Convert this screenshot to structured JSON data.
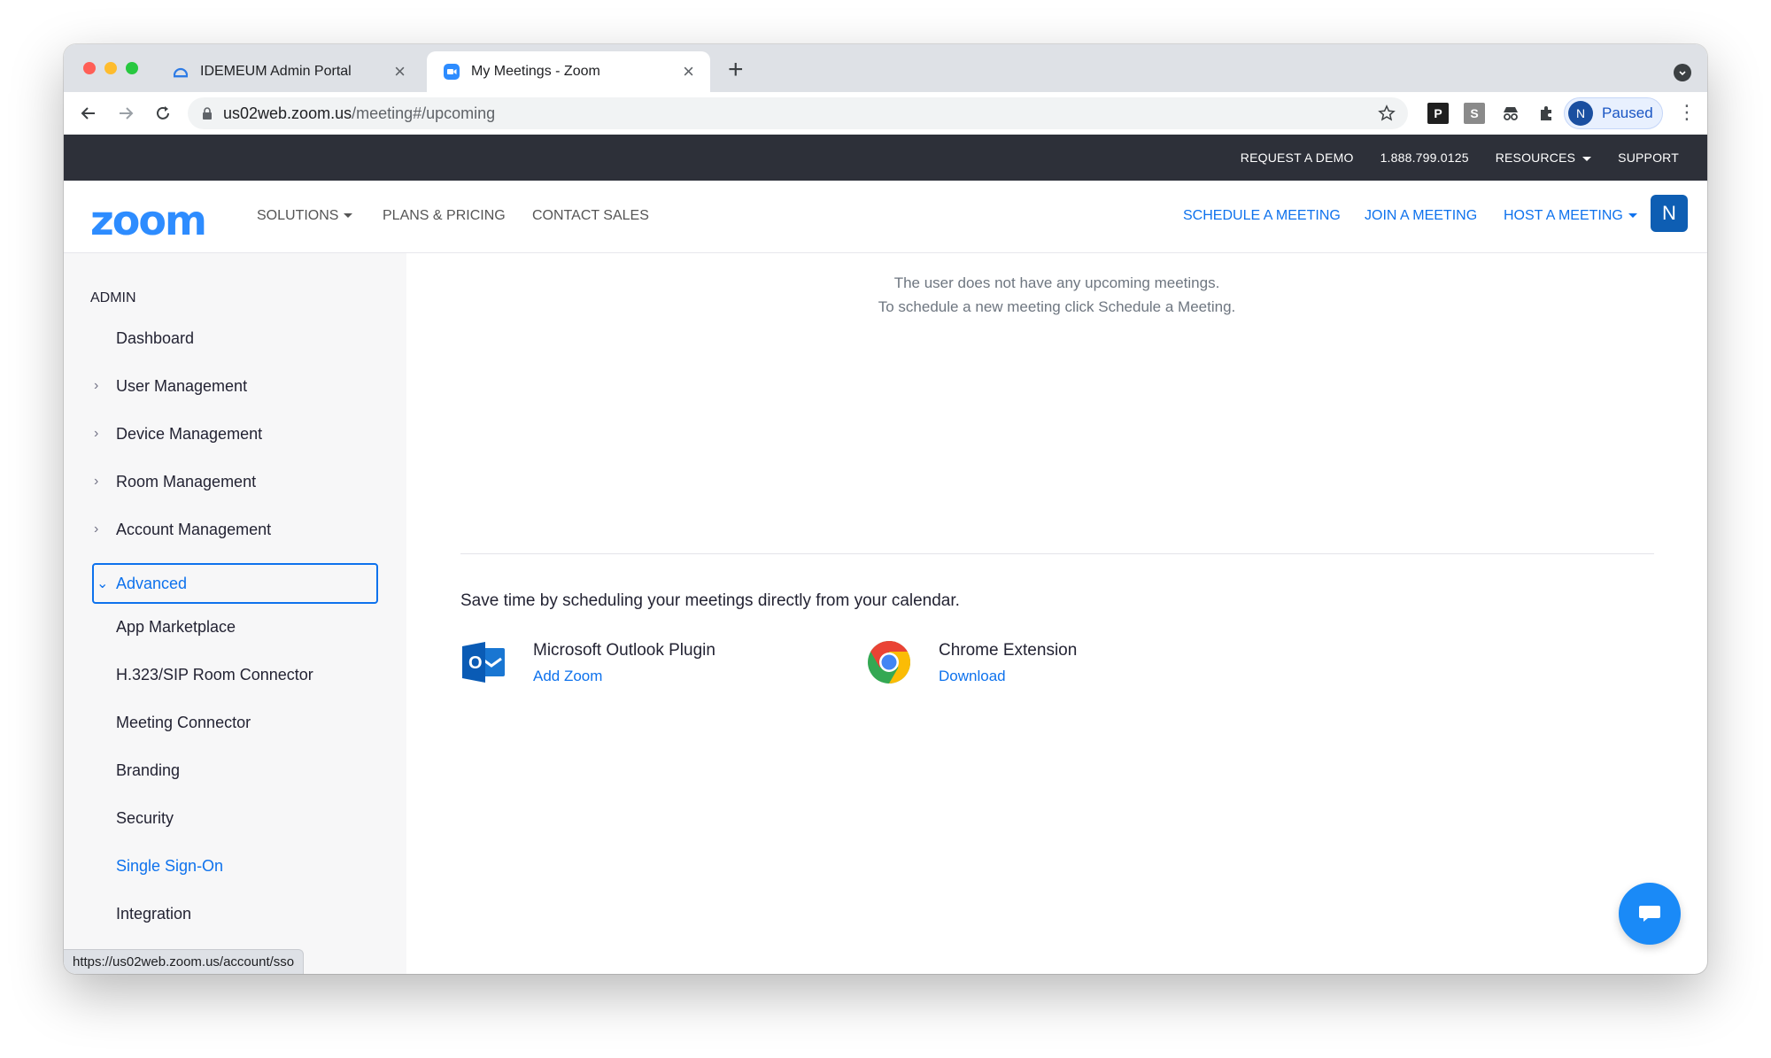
{
  "browser": {
    "tabs": [
      {
        "title": "IDEMEUM Admin Portal",
        "active": false
      },
      {
        "title": "My Meetings - Zoom",
        "active": true
      }
    ],
    "url_host": "us02web.zoom.us",
    "url_path": "/meeting#/upcoming",
    "profile_initial": "N",
    "profile_status": "Paused",
    "ext_p": "P",
    "ext_s": "S",
    "status_url": "https://us02web.zoom.us/account/sso"
  },
  "topbar": {
    "request_demo": "REQUEST A DEMO",
    "phone": "1.888.799.0125",
    "resources": "RESOURCES",
    "support": "SUPPORT"
  },
  "header": {
    "logo": "zoom",
    "solutions": "SOLUTIONS",
    "plans": "PLANS & PRICING",
    "contact": "CONTACT SALES",
    "schedule": "SCHEDULE A MEETING",
    "join": "JOIN A MEETING",
    "host": "HOST A MEETING",
    "avatar_initial": "N"
  },
  "sidebar": {
    "section": "ADMIN",
    "items": [
      {
        "label": "Dashboard"
      },
      {
        "label": "User Management"
      },
      {
        "label": "Device Management"
      },
      {
        "label": "Room Management"
      },
      {
        "label": "Account Management"
      },
      {
        "label": "Advanced"
      },
      {
        "label": "App Marketplace"
      },
      {
        "label": "H.323/SIP Room Connector"
      },
      {
        "label": "Meeting Connector"
      },
      {
        "label": "Branding"
      },
      {
        "label": "Security"
      },
      {
        "label": "Single Sign-On"
      },
      {
        "label": "Integration"
      }
    ]
  },
  "main": {
    "empty_line1": "The user does not have any upcoming meetings.",
    "empty_line2": "To schedule a new meeting click Schedule a Meeting.",
    "save_text": "Save time by scheduling your meetings directly from your calendar.",
    "outlook_title": "Microsoft Outlook Plugin",
    "outlook_link": "Add Zoom",
    "outlook_letter": "O",
    "chrome_title": "Chrome Extension",
    "chrome_link": "Download"
  },
  "colors": {
    "zoom_blue": "#0e72ed",
    "logo_blue": "#2d8cff",
    "topbar_bg": "#2d3039",
    "sidebar_bg": "#f7f7f8"
  }
}
